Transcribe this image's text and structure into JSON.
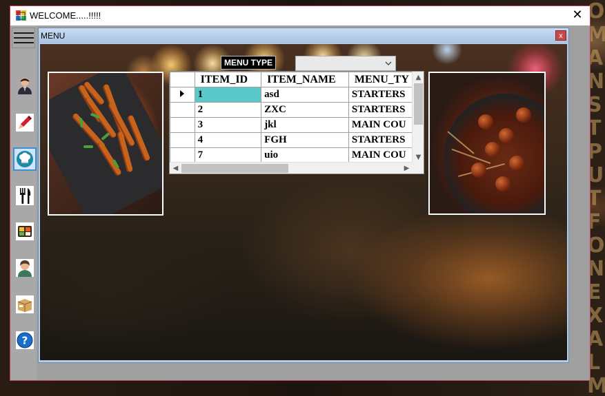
{
  "window": {
    "title": "WELCOME.....!!!!!",
    "close_glyph": "✕"
  },
  "toolbar": {
    "items": [
      {
        "name": "user-icon"
      },
      {
        "name": "pen-icon"
      },
      {
        "name": "chef-hat-icon",
        "selected": true
      },
      {
        "name": "fork-knife-icon"
      },
      {
        "name": "bento-icon"
      },
      {
        "name": "staff-icon"
      },
      {
        "name": "box-icon"
      },
      {
        "name": "help-icon"
      }
    ]
  },
  "child": {
    "title": "MENU",
    "close_glyph": "x"
  },
  "menu_type": {
    "label": "MENU TYPE",
    "selected": ""
  },
  "grid": {
    "columns": [
      "ITEM_ID",
      "ITEM_NAME",
      "MENU_TY"
    ],
    "rows": [
      {
        "id": "1",
        "name": "asd",
        "type": "STARTERS",
        "current": true
      },
      {
        "id": "2",
        "name": "ZXC",
        "type": "STARTERS"
      },
      {
        "id": "3",
        "name": "jkl",
        "type": "MAIN COU"
      },
      {
        "id": "4",
        "name": "FGH",
        "type": "STARTERS"
      },
      {
        "id": "7",
        "name": "uio",
        "type": "MAIN COU"
      }
    ]
  },
  "colors": {
    "selected_cell": "#5bc9c9",
    "window_border": "#c04060",
    "selected_tool": "#3a8fd8"
  }
}
